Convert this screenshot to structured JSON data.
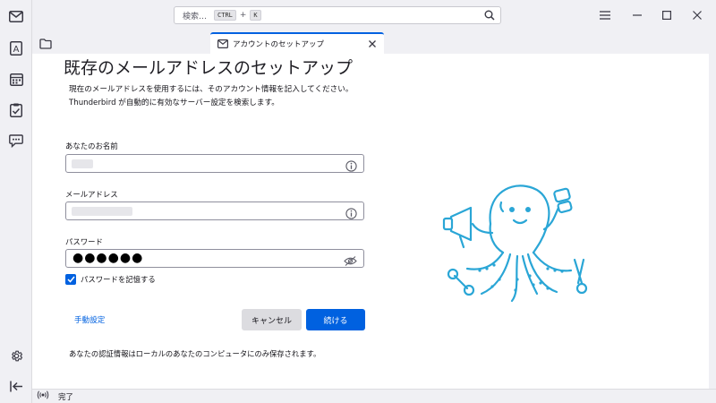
{
  "titlebar": {
    "search_placeholder": "検索…",
    "shortcut_key1": "CTRL",
    "shortcut_plus": "+",
    "shortcut_key2": "K"
  },
  "tabs": [
    {
      "label": "アカウントのセットアップ"
    }
  ],
  "page": {
    "title": "既存のメールアドレスのセットアップ",
    "desc_line1": "現在のメールアドレスを使用するには、そのアカウント情報を記入してください。",
    "desc_line2": "Thunderbird が自動的に有効なサーバー設定を検索します。",
    "name_label": "あなたのお名前",
    "email_label": "メールアドレス",
    "password_label": "パスワード",
    "password_value": "●●●●●●",
    "remember_label": "パスワードを記憶する",
    "remember_checked": true,
    "manual_link": "手動設定",
    "cancel_label": "キャンセル",
    "continue_label": "続ける",
    "note": "あなたの認証情報はローカルのあなたのコンピュータにのみ保存されます。"
  },
  "status": {
    "text": "完了"
  },
  "colors": {
    "accent": "#0061e0",
    "octopus": "#2aa6d6"
  }
}
